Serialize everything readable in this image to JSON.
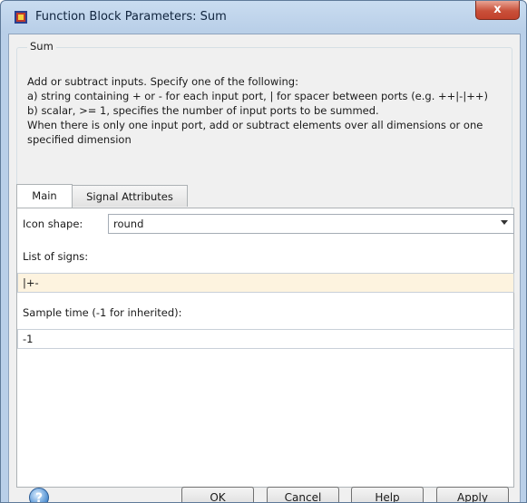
{
  "window": {
    "title": "Function Block Parameters: Sum",
    "close_glyph": "x"
  },
  "group": {
    "label": "Sum",
    "description": [
      "Add or subtract inputs.  Specify one of the following:",
      "a) string containing + or - for each input port, | for spacer between ports (e.g. ++|-|++)",
      "b) scalar, >= 1, specifies the number of input ports to be summed.",
      "When there is only one input port, add or subtract elements over all dimensions or one",
      "specified dimension"
    ]
  },
  "tabs": [
    {
      "label": "Main"
    },
    {
      "label": "Signal Attributes"
    }
  ],
  "main": {
    "icon_shape_label": "Icon shape:",
    "icon_shape_value": "round",
    "list_of_signs_label": "List of signs:",
    "list_of_signs_value": "|+-",
    "sample_time_label": "Sample time (-1 for inherited):",
    "sample_time_value": "-1"
  },
  "buttons": {
    "ok": "OK",
    "cancel": "Cancel",
    "help": "Help",
    "apply": "Apply",
    "help_icon_glyph": "?"
  },
  "colors": {
    "highlight_field": "#fdf3df",
    "title_bar": "#c9dcf0"
  }
}
